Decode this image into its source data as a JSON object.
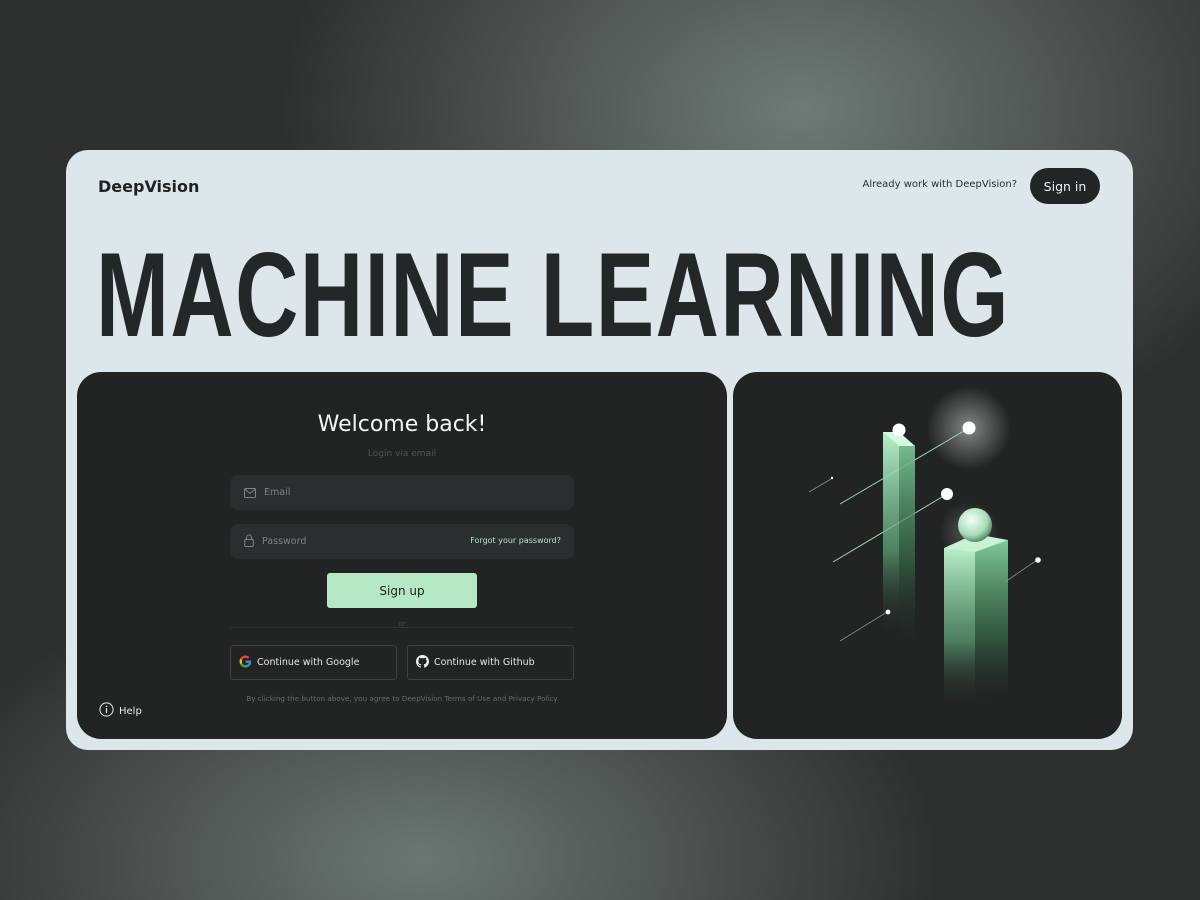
{
  "brand": {
    "name": "DeepVision"
  },
  "header": {
    "already_text": "Already work with DeepVision?",
    "signin_label": "Sign in"
  },
  "hero": {
    "headline": "MACHINE LEARNING"
  },
  "login": {
    "title": "Welcome back!",
    "subtitle": "Login via email",
    "email_placeholder": "Email",
    "password_placeholder": "Password",
    "forgot_label": "Forgot your password?",
    "signup_label": "Sign up",
    "or_text": "or",
    "google_label": "Continue with Google",
    "github_label": "Continue with Github",
    "terms_text": "By clicking the button above, you agree to DeepVision Terms of Use and Privacy Policy"
  },
  "footer": {
    "help_label": "Help"
  },
  "colors": {
    "accent": "#b5e8c5",
    "panel": "#222424",
    "frame": "#dde6ea",
    "text_dark": "#232727"
  },
  "icons": [
    "mail-icon",
    "lock-icon",
    "google-icon",
    "github-icon",
    "info-icon"
  ]
}
